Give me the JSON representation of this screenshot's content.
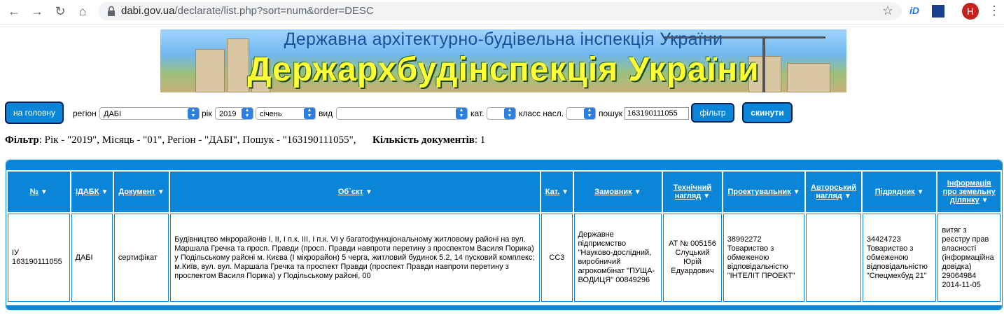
{
  "browser": {
    "url_host": "dabi.gov.ua",
    "url_path": "/declarate/list.php?sort=num&order=DESC",
    "avatar_letter": "Н",
    "ext1": "iD"
  },
  "banner": {
    "line1": "Державна архітектурно-будівельна інспекція України",
    "line2": "Держархбудінспекція України"
  },
  "filters": {
    "home_button": "на головну",
    "region_label": "регіон",
    "region_value": "ДАБІ",
    "year_label": "рік",
    "year_value": "2019",
    "month_value": "січень",
    "type_label": "вид",
    "type_value": "",
    "cat_label": "кат.",
    "cat_value": "",
    "class_label": "класс насл.",
    "class_value": "",
    "search_label": "пошук",
    "search_value": "163190111055",
    "filter_button": "фільтр",
    "reset_button": "скинути"
  },
  "summary": {
    "filter_label": "Фільтр",
    "filter_text": ": Рік - \"2019\", Місяць - \"01\", Регіон - \"ДАБІ\", Пошук - \"163190111055\",",
    "count_label": "Кількість документів",
    "count_value": ": 1"
  },
  "table": {
    "headers": [
      "№",
      "ІДАБК",
      "Документ",
      "Об`єкт",
      "Кат.",
      "Замовник",
      "Технічний нагляд",
      "Проектувальник",
      "Авторський нагляд",
      "Підрядник",
      "Інформація про земельну ділянку"
    ],
    "row": {
      "num": "ІУ 163190111055",
      "idabk": "ДАБІ",
      "document": "сертифікат",
      "object": "Будівництво мікрорайонів І, ІІ, І п.к. ІІІ, І п.к. VI у багатофункціональному житловому районі на вул. Маршала Гречка та просп. Правди (просп. Правди навпроти перетину з проспектом Василя Порика) у Подільському районі м. Києва (І мікрорайон) 5 черга, житловий будинок 5.2, 14 пусковий комплекс; м.Київ, вул. вул. Маршала Гречка та проспект Правди (проспект Правди навпроти перетину з проспектом Василя Порика) у Подільському районі, 00",
      "cat": "СС3",
      "customer": "Державне підприємство \"Науково-дослідний, виробничий агрокомбінат \"ПУЩА-ВОДИЦЯ\" 00849296",
      "tech_supervision": "АТ № 005156 Слуцький Юрій Едуардович",
      "designer": "38992272 Товариство з обмеженою відповідальністю \"ІНТЕЛІТ ПРОЕКТ\"",
      "author_supervision": "",
      "contractor": "34424723 Товариство з обмеженою відповідальністю \"Спецмехбуд 21\"",
      "land_info": "витяг з реєстру прав власності (інформаційна довідка) 29064984 2014-11-05"
    }
  }
}
